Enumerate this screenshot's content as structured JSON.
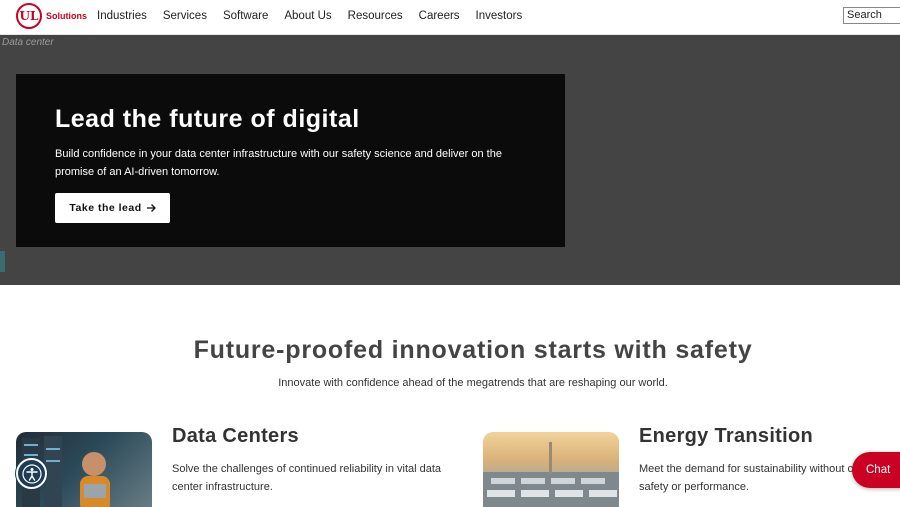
{
  "header": {
    "logo_mark": "UL",
    "logo_text": "Solutions",
    "nav": [
      "Industries",
      "Services",
      "Software",
      "About Us",
      "Resources",
      "Careers",
      "Investors"
    ],
    "search_placeholder": "Search"
  },
  "hero": {
    "image_alt": "Data center",
    "title": "Lead the future of digital",
    "description": "Build confidence in your data center infrastructure with our safety science and deliver on the promise of an AI-driven tomorrow.",
    "button_label": "Take the lead",
    "button_icon": "arrow-right-icon"
  },
  "section": {
    "title": "Future-proofed innovation starts with safety",
    "subtitle": "Innovate with confidence ahead of the megatrends that are reshaping our world."
  },
  "cards": [
    {
      "title": "Data Centers",
      "description": "Solve the challenges of continued reliability in vital data center infrastructure."
    },
    {
      "title": "Energy Transition",
      "description": "Meet the demand for sustainability without compromising safety or performance."
    }
  ],
  "widgets": {
    "accessibility_icon": "accessibility-icon",
    "chat_label": "Chat"
  },
  "colors": {
    "brand_red": "#ca0123",
    "hero_bg": "#444444",
    "hero_card": "#0b0b0b"
  }
}
